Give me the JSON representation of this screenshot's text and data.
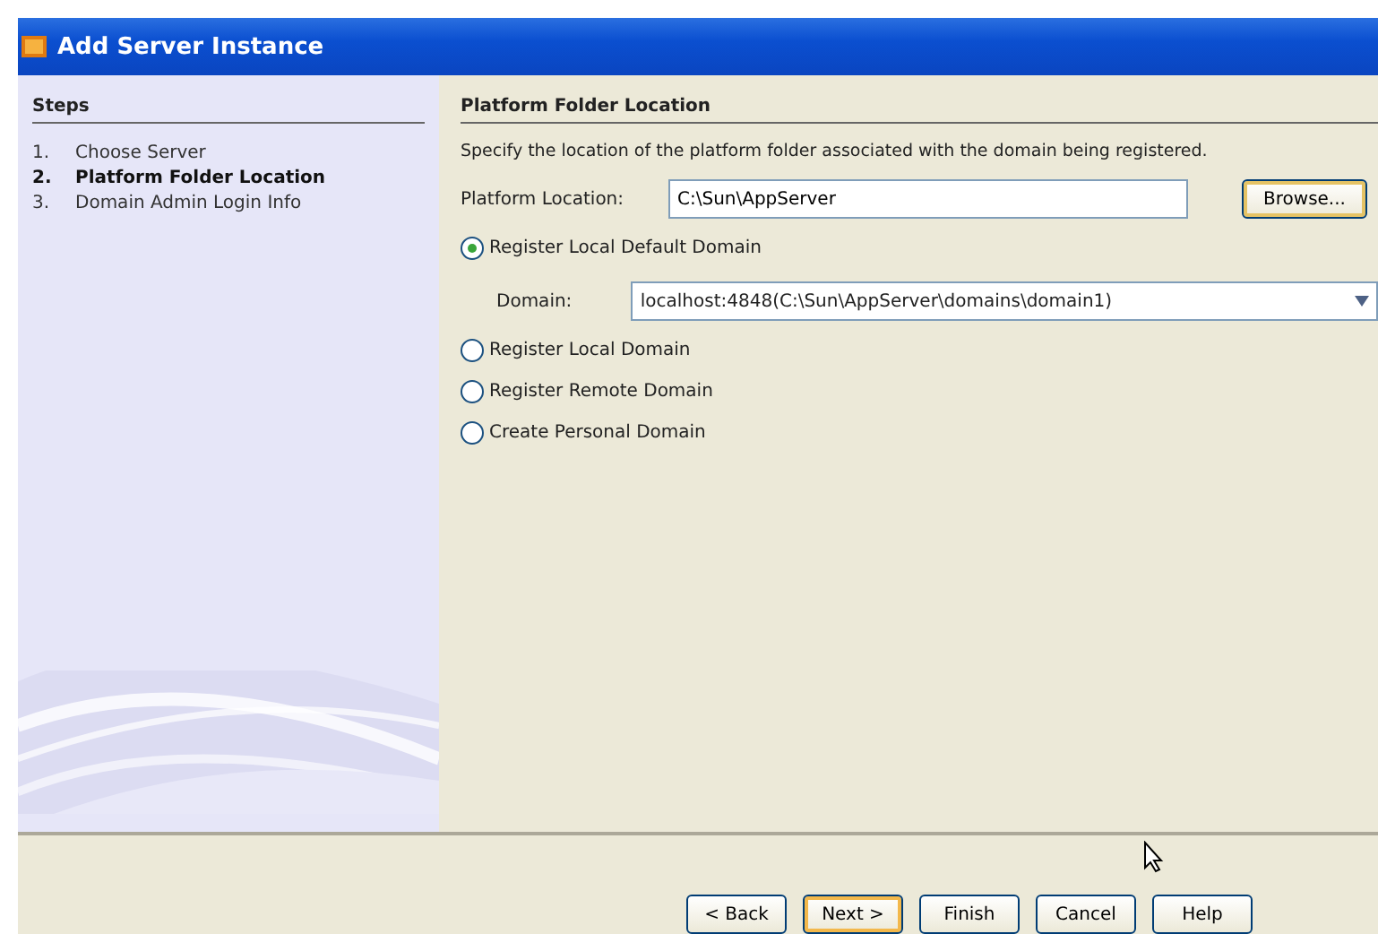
{
  "window": {
    "title": "Add Server Instance"
  },
  "steps": {
    "title": "Steps",
    "items": [
      {
        "number": "1.",
        "label": "Choose Server",
        "selected": false
      },
      {
        "number": "2.",
        "label": "Platform Folder Location",
        "selected": true
      },
      {
        "number": "3.",
        "label": "Domain Admin Login Info",
        "selected": false
      }
    ]
  },
  "panel": {
    "title": "Platform Folder Location",
    "description": "Specify the location of the platform folder associated with the domain being registered.",
    "location": {
      "label": "Platform Location:",
      "value": "C:\\Sun\\AppServer",
      "button": "Browse..."
    },
    "options": [
      {
        "label": "Register Local Default Domain",
        "selected": true,
        "domain": {
          "label": "Domain:",
          "value": "localhost:4848(C:\\Sun\\AppServer\\domains\\domain1)"
        }
      },
      {
        "label": "Register Local Domain",
        "selected": false
      },
      {
        "label": "Register Remote Domain",
        "selected": false
      },
      {
        "label": "Create Personal Domain",
        "selected": false
      }
    ]
  },
  "buttons": [
    {
      "label": "< Back",
      "focused": false
    },
    {
      "label": "Next >",
      "focused": true
    },
    {
      "label": "Finish",
      "focused": false
    },
    {
      "label": "Cancel",
      "focused": false
    },
    {
      "label": "Help",
      "focused": false
    }
  ]
}
